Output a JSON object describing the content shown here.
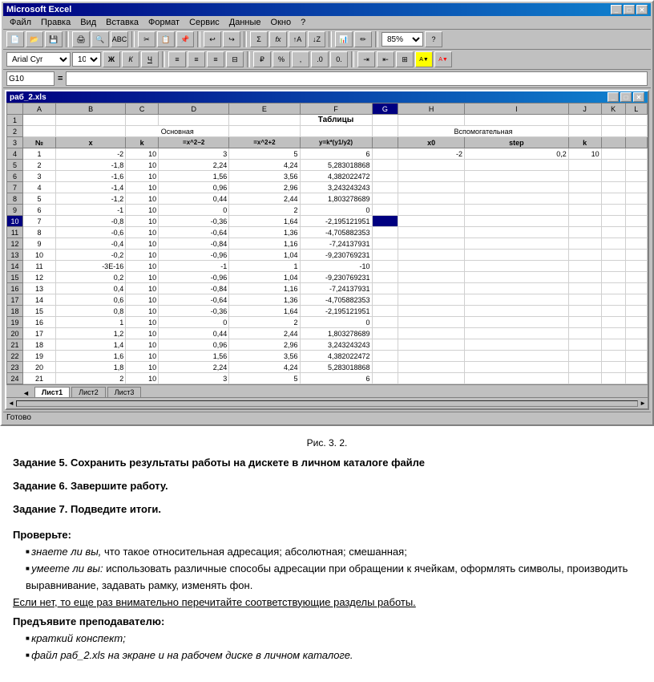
{
  "app": {
    "title": "Microsoft Excel",
    "title_icon": "excel-icon"
  },
  "menu": {
    "items": [
      "Файл",
      "Правка",
      "Вид",
      "Вставка",
      "Формат",
      "Сервис",
      "Данные",
      "Окно",
      "?"
    ]
  },
  "toolbar2": {
    "font_name": "Arial Cyr",
    "font_size": "10",
    "zoom": "85%"
  },
  "formula_bar": {
    "name_box": "G10",
    "formula": "="
  },
  "spreadsheet": {
    "title": "раб_2.xls",
    "columns": [
      "A",
      "B",
      "C",
      "D",
      "E",
      "F",
      "G",
      "H",
      "I",
      "J",
      "K",
      "L"
    ],
    "rows": [
      {
        "num": "1",
        "cells": [
          "",
          "",
          "",
          "",
          "",
          "Таблицы",
          "",
          "",
          "",
          "",
          "",
          ""
        ]
      },
      {
        "num": "2",
        "cells": [
          "",
          "",
          "",
          "Основная",
          "",
          "",
          "",
          "",
          "Вспомогательная",
          "",
          "",
          ""
        ]
      },
      {
        "num": "3",
        "cells": [
          "№",
          "x",
          "k",
          "=x^2−2",
          "=x^2+2",
          "y=k*(y1/y2)",
          "",
          "x0",
          "step",
          "k",
          "",
          ""
        ]
      },
      {
        "num": "4",
        "cells": [
          "1",
          "-2",
          "10",
          "3",
          "5",
          "6",
          "",
          "",
          "",
          "",
          "",
          ""
        ]
      },
      {
        "num": "5",
        "cells": [
          "2",
          "-1,8",
          "10",
          "2,24",
          "4,24",
          "5,283018868",
          "",
          "",
          "",
          "",
          "",
          ""
        ]
      },
      {
        "num": "6",
        "cells": [
          "3",
          "-1,6",
          "10",
          "1,56",
          "3,56",
          "4,382022472",
          "",
          "",
          "",
          "",
          "",
          ""
        ]
      },
      {
        "num": "7",
        "cells": [
          "4",
          "-1,4",
          "10",
          "0,96",
          "2,96",
          "3,243243243",
          "",
          "",
          "",
          "",
          "",
          ""
        ]
      },
      {
        "num": "8",
        "cells": [
          "5",
          "-1,2",
          "10",
          "0,44",
          "2,44",
          "1,803278689",
          "",
          "",
          "",
          "",
          "",
          ""
        ]
      },
      {
        "num": "9",
        "cells": [
          "6",
          "-1",
          "10",
          "0",
          "2",
          "0",
          "",
          "",
          "",
          "",
          "",
          ""
        ]
      },
      {
        "num": "10",
        "cells": [
          "7",
          "-0,8",
          "10",
          "-0,36",
          "1,64",
          "-2,195121951",
          "",
          "",
          "",
          "",
          "",
          ""
        ],
        "selected_col": "G"
      },
      {
        "num": "11",
        "cells": [
          "8",
          "-0,6",
          "10",
          "-0,64",
          "1,36",
          "-4,705882353",
          "",
          "",
          "",
          "",
          "",
          ""
        ]
      },
      {
        "num": "12",
        "cells": [
          "9",
          "-0,4",
          "10",
          "-0,84",
          "1,16",
          "-7,24137931",
          "",
          "",
          "",
          "",
          "",
          ""
        ]
      },
      {
        "num": "13",
        "cells": [
          "10",
          "-0,2",
          "10",
          "-0,96",
          "1,04",
          "-9,230769231",
          "",
          "",
          "",
          "",
          "",
          ""
        ]
      },
      {
        "num": "14",
        "cells": [
          "11",
          "-3E-16",
          "10",
          "-1",
          "1",
          "-10",
          "",
          "",
          "",
          "",
          "",
          ""
        ]
      },
      {
        "num": "15",
        "cells": [
          "12",
          "0,2",
          "10",
          "-0,96",
          "1,04",
          "-9,230769231",
          "",
          "",
          "",
          "",
          "",
          ""
        ]
      },
      {
        "num": "16",
        "cells": [
          "13",
          "0,4",
          "10",
          "-0,84",
          "1,16",
          "-7,24137931",
          "",
          "",
          "",
          "",
          "",
          ""
        ]
      },
      {
        "num": "17",
        "cells": [
          "14",
          "0,6",
          "10",
          "-0,64",
          "1,36",
          "-4,705882353",
          "",
          "",
          "",
          "",
          "",
          ""
        ]
      },
      {
        "num": "18",
        "cells": [
          "15",
          "0,8",
          "10",
          "-0,36",
          "1,64",
          "-2,195121951",
          "",
          "",
          "",
          "",
          "",
          ""
        ]
      },
      {
        "num": "19",
        "cells": [
          "16",
          "1",
          "10",
          "0",
          "2",
          "0",
          "",
          "",
          "",
          "",
          "",
          ""
        ]
      },
      {
        "num": "20",
        "cells": [
          "17",
          "1,2",
          "10",
          "0,44",
          "2,44",
          "1,803278689",
          "",
          "",
          "",
          "",
          "",
          ""
        ]
      },
      {
        "num": "21",
        "cells": [
          "18",
          "1,4",
          "10",
          "0,96",
          "2,96",
          "3,243243243",
          "",
          "",
          "",
          "",
          "",
          ""
        ]
      },
      {
        "num": "22",
        "cells": [
          "19",
          "1,6",
          "10",
          "1,56",
          "3,56",
          "4,382022472",
          "",
          "",
          "",
          "",
          "",
          ""
        ]
      },
      {
        "num": "23",
        "cells": [
          "20",
          "1,8",
          "10",
          "2,24",
          "4,24",
          "5,283018868",
          "",
          "",
          "",
          "",
          "",
          ""
        ]
      },
      {
        "num": "24",
        "cells": [
          "21",
          "2",
          "10",
          "3",
          "5",
          "6",
          "",
          "",
          "",
          "",
          "",
          ""
        ]
      }
    ],
    "aux_row4": {
      "x0": "-2",
      "step": "0,2",
      "k": "10"
    },
    "sheets": [
      "Лист1",
      "Лист2",
      "Лист3"
    ]
  },
  "status_bar": "Готово",
  "figure_caption": "Рис. 3. 2.",
  "tasks": [
    {
      "id": "task5",
      "label": "Задание 5.",
      "text": " Сохранить результаты работы на дискете в личном каталоге файле"
    },
    {
      "id": "task6",
      "label": "Задание 6.",
      "text": " Завершите работу."
    },
    {
      "id": "task7",
      "label": "Задание 7.",
      "text": " Подведите итоги."
    }
  ],
  "check_section": {
    "header": "Проверьте:",
    "items": [
      {
        "italic_part": "знаете ли вы,",
        "normal_part": " что такое относительная адресация; абсолютная; смешанная;"
      },
      {
        "italic_part": "умеете  ли вы:",
        "normal_part": " использовать различные способы адресации при обращении к ячейкам, оформлять символы, производить выравнивание,  задавать рамку, изменять фон."
      }
    ],
    "underline_text": "Если нет, то еще раз внимательно перечитайте соответствующие разделы работы.",
    "present_header": "Предъявите преподавателю:",
    "present_items": [
      "краткий конспект;",
      "файл раб_2.xls на экране и на рабочем диске в личном каталоге."
    ]
  }
}
